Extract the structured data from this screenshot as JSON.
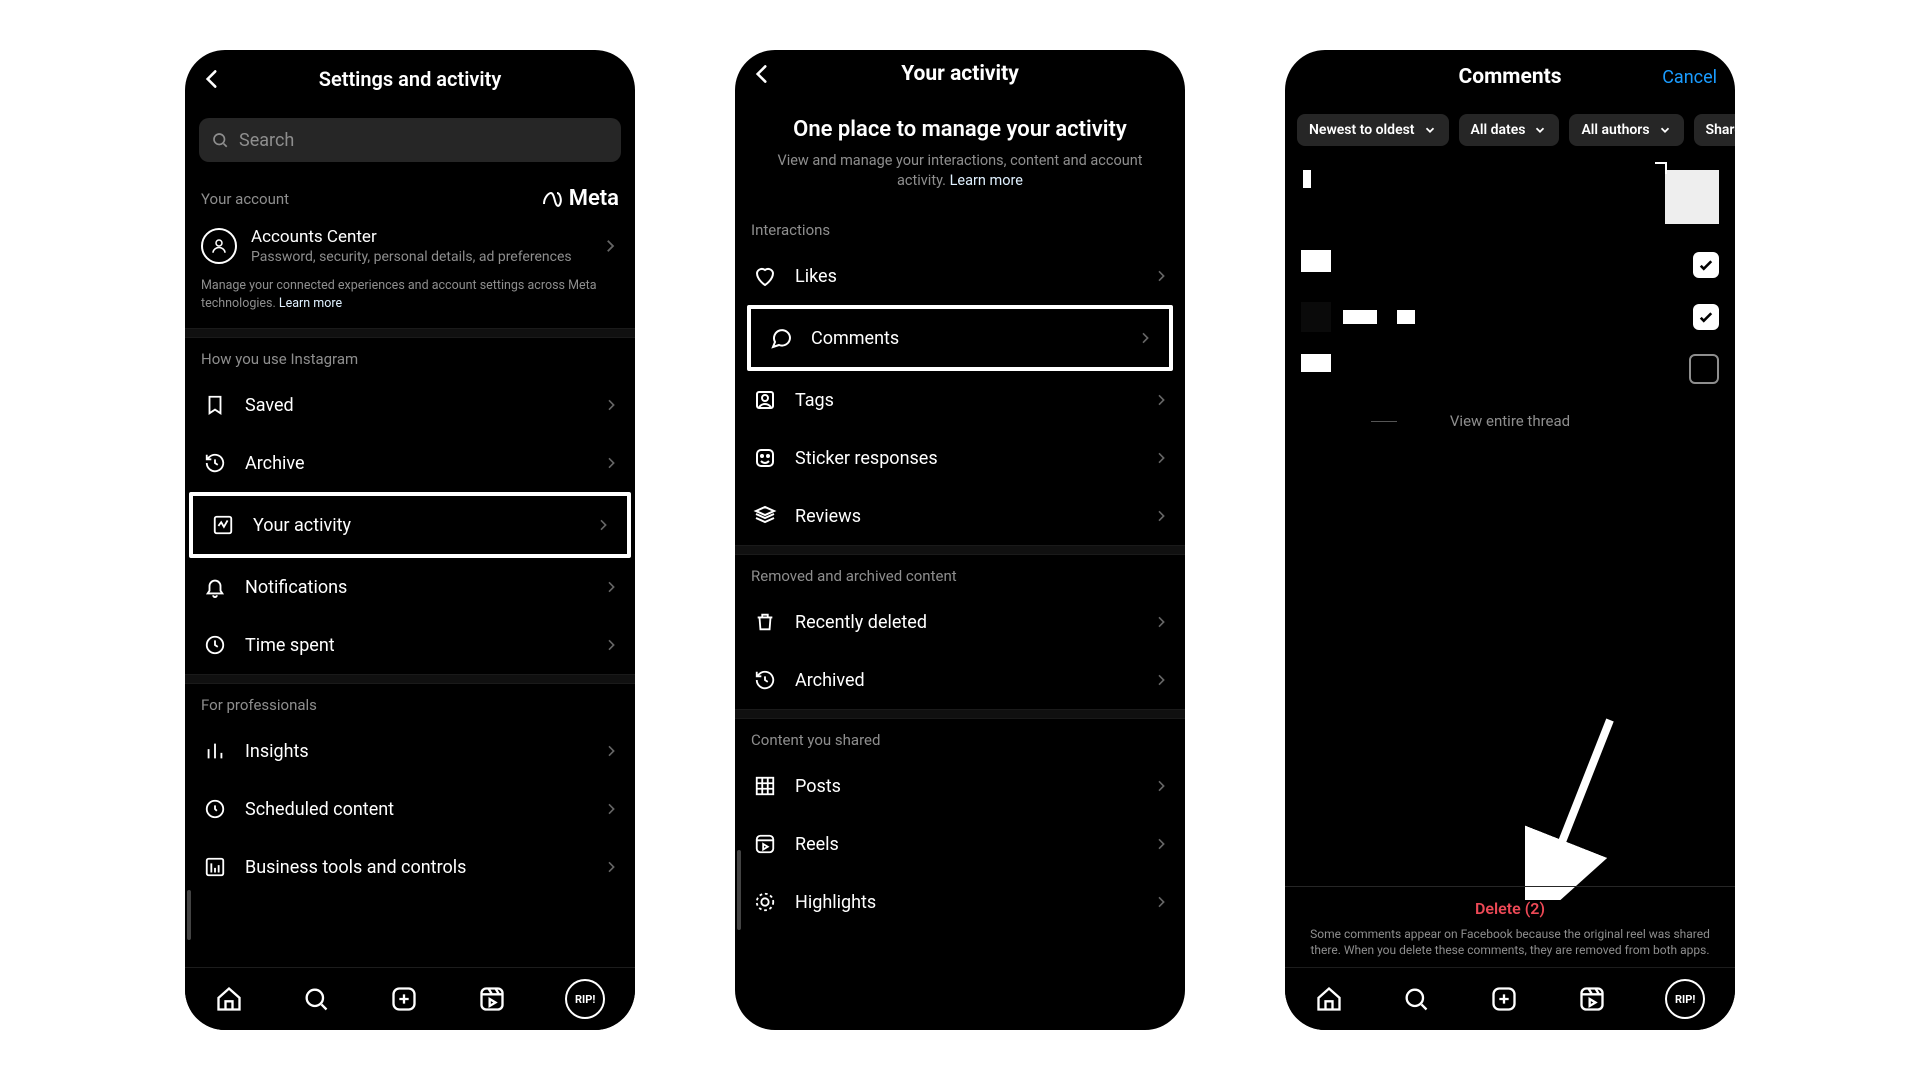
{
  "screen1": {
    "title": "Settings and activity",
    "search_placeholder": "Search",
    "your_account_label": "Your account",
    "meta_brand": "Meta",
    "accounts_center": "Accounts Center",
    "accounts_sub": "Password, security, personal details, ad preferences",
    "fine_print": "Manage your connected experiences and account settings across Meta technologies. ",
    "learn_more": "Learn more",
    "how_you_use": "How you use Instagram",
    "rows_a": [
      {
        "label": "Saved",
        "icon": "bookmark"
      },
      {
        "label": "Archive",
        "icon": "history"
      },
      {
        "label": "Your activity",
        "icon": "activity"
      },
      {
        "label": "Notifications",
        "icon": "bell"
      },
      {
        "label": "Time spent",
        "icon": "clock"
      }
    ],
    "for_pros": "For professionals",
    "rows_b": [
      {
        "label": "Insights",
        "icon": "bars"
      },
      {
        "label": "Scheduled content",
        "icon": "schedule"
      },
      {
        "label": "Business tools and controls",
        "icon": "biztools"
      }
    ]
  },
  "screen2": {
    "title": "Your activity",
    "heading": "One place to manage your activity",
    "sub": "View and manage your interactions, content and account activity. ",
    "learn_more": "Learn more",
    "sec_interactions": "Interactions",
    "rows_int": [
      {
        "label": "Likes",
        "icon": "heart"
      },
      {
        "label": "Comments",
        "icon": "comment"
      },
      {
        "label": "Tags",
        "icon": "tag"
      },
      {
        "label": "Sticker responses",
        "icon": "sticker"
      },
      {
        "label": "Reviews",
        "icon": "review"
      }
    ],
    "sec_removed": "Removed and archived content",
    "rows_rem": [
      {
        "label": "Recently deleted",
        "icon": "trash"
      },
      {
        "label": "Archived",
        "icon": "history"
      }
    ],
    "sec_shared": "Content you shared",
    "rows_share": [
      {
        "label": "Posts",
        "icon": "grid"
      },
      {
        "label": "Reels",
        "icon": "reels"
      },
      {
        "label": "Highlights",
        "icon": "highlight"
      }
    ]
  },
  "screen3": {
    "title": "Comments",
    "cancel": "Cancel",
    "filter_sort": "Newest to oldest",
    "filter_dates": "All dates",
    "filter_authors": "All authors",
    "filter_shared": "Shared to",
    "view_thread": "View entire thread",
    "delete_label": "Delete (2)",
    "delete_note": "Some comments appear on Facebook because the original reel was shared there. When you delete these comments, they are removed from both apps."
  }
}
